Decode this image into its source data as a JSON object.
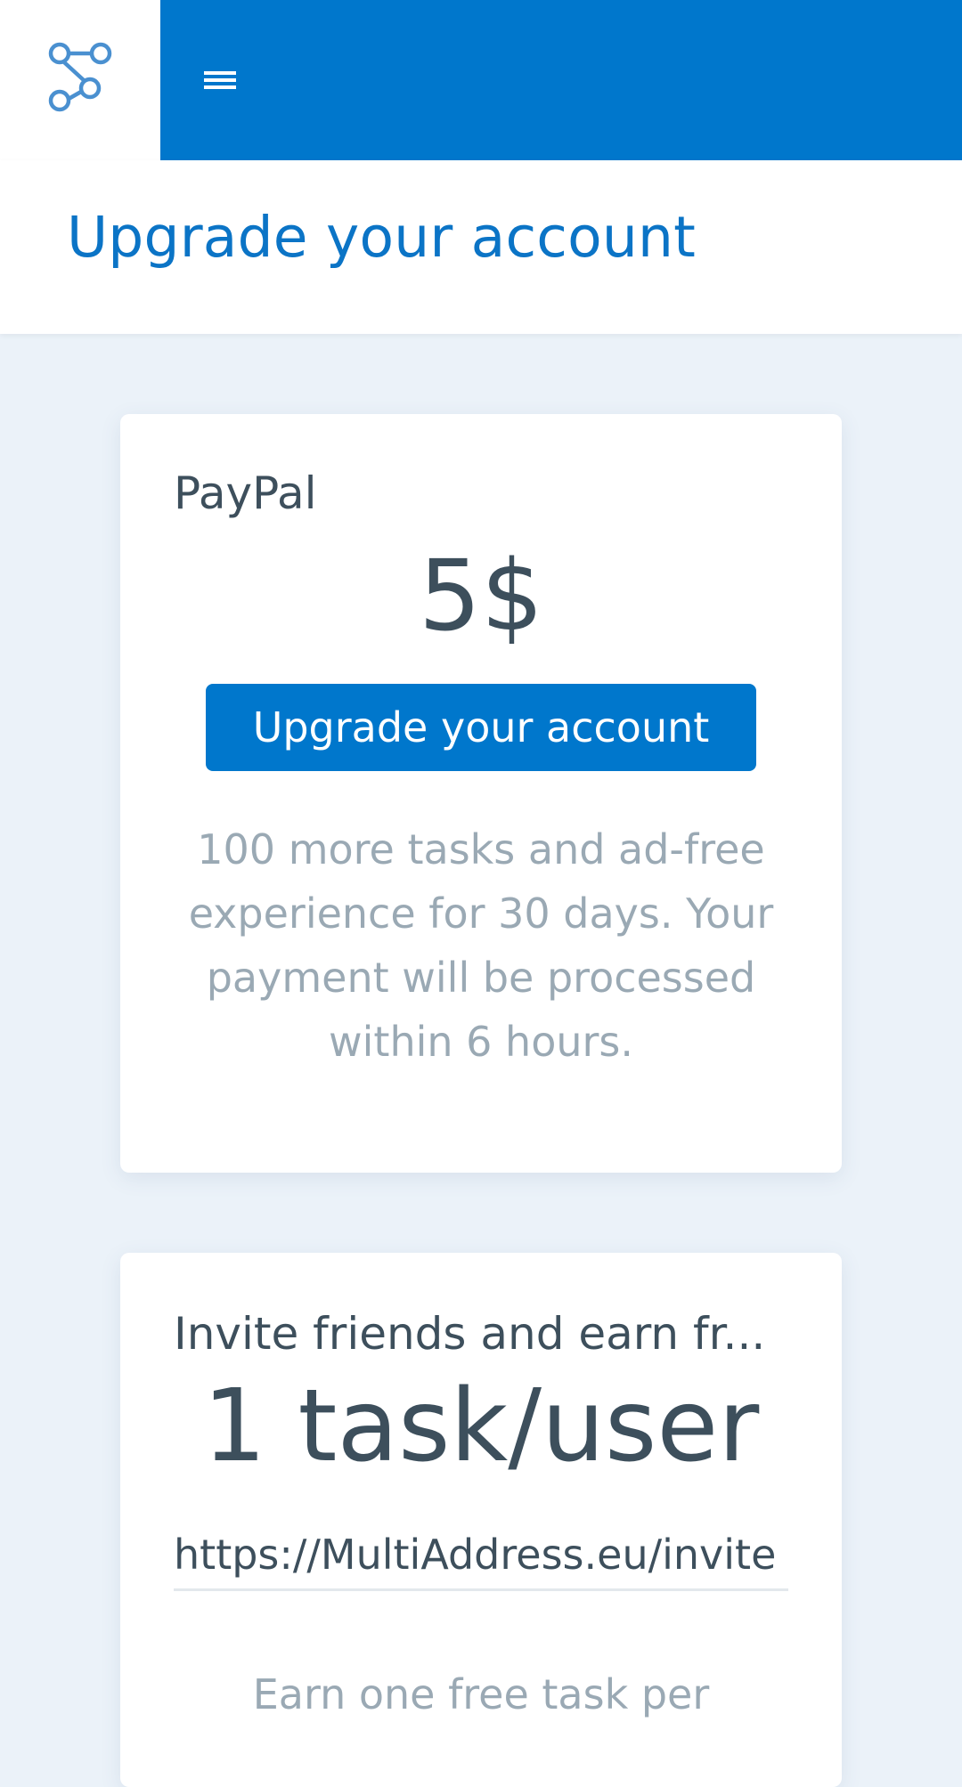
{
  "colors": {
    "brand": "#0077cc",
    "background": "#ebf2f9",
    "text_dark": "#3d4f5c",
    "text_muted": "#9aa9b4"
  },
  "topbar": {
    "logo_icon": "share-nodes-icon",
    "menu_icon": "hamburger-menu-icon"
  },
  "header": {
    "title": "Upgrade your account"
  },
  "paypal_card": {
    "label": "PayPal",
    "price": "5$",
    "button_label": "Upgrade your account",
    "description": "100 more tasks and ad-free experience for 30 days. Your payment will be processed within 6 hours."
  },
  "invite_card": {
    "label": "Invite friends and earn fr...",
    "reward": "1 task/user",
    "invite_link": "https://MultiAddress.eu/invite",
    "description": "Earn one free task per"
  }
}
